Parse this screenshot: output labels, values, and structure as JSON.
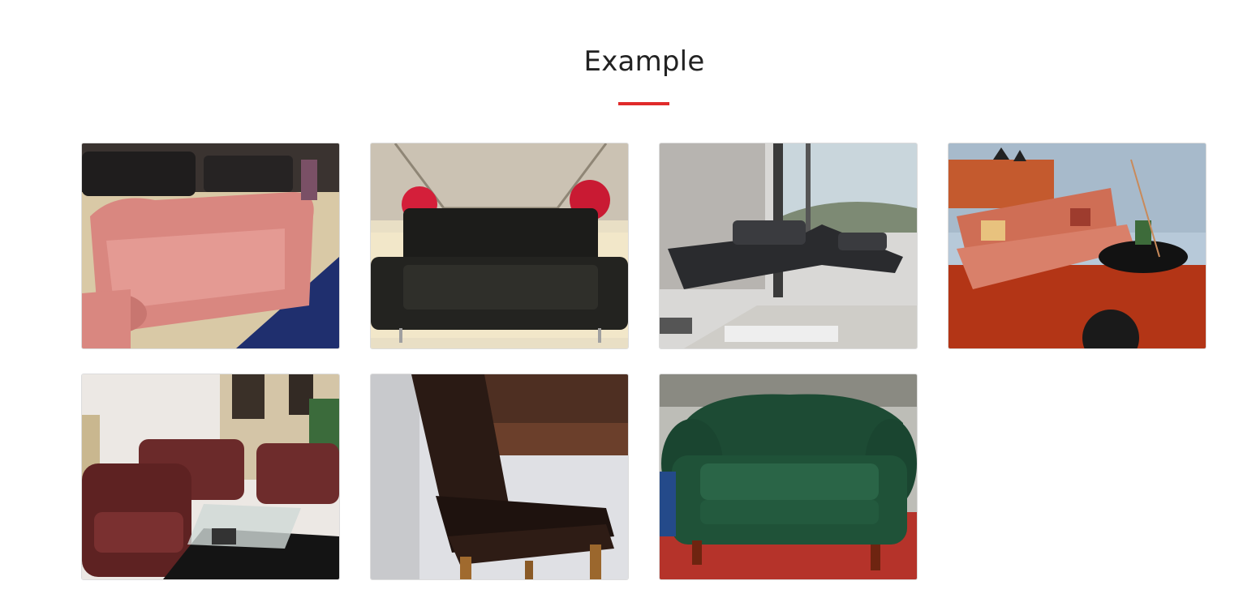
{
  "section": {
    "title": "Example",
    "accent_color": "#e02b2b"
  },
  "gallery": {
    "items": [
      {
        "icon": "pink-tufted-sofa-photo"
      },
      {
        "icon": "black-leather-loveseat-photo"
      },
      {
        "icon": "grey-corner-sofa-photo"
      },
      {
        "icon": "coral-sofa-livingroom-photo"
      },
      {
        "icon": "burgundy-recliner-set-photo"
      },
      {
        "icon": "dark-leather-dining-chair-photo"
      },
      {
        "icon": "green-chesterfield-armchair-photo"
      }
    ]
  }
}
